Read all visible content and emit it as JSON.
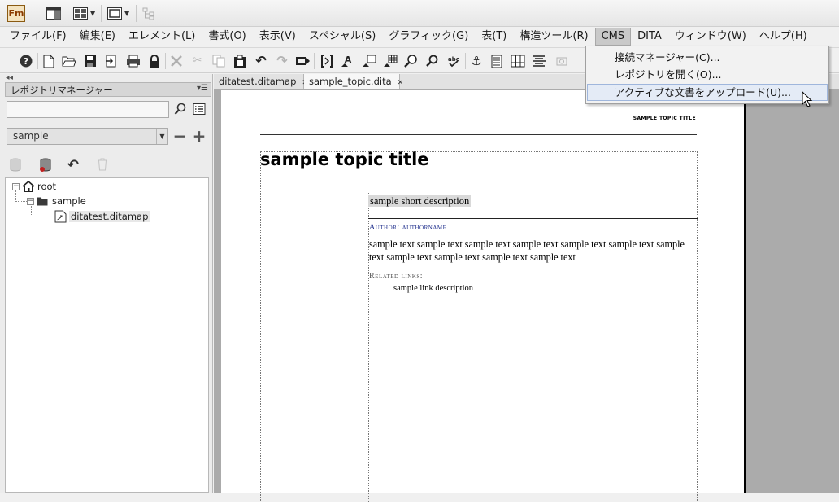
{
  "app": {
    "logo_text": "Fm",
    "titlebar_icons": [
      "workspace-icon",
      "layout-grid-icon",
      "frame-view-icon",
      "tree-disabled-icon"
    ]
  },
  "menubar": {
    "items": [
      {
        "label": "ファイル(F)"
      },
      {
        "label": "編集(E)"
      },
      {
        "label": "エレメント(L)"
      },
      {
        "label": "書式(O)"
      },
      {
        "label": "表示(V)"
      },
      {
        "label": "スペシャル(S)"
      },
      {
        "label": "グラフィック(G)"
      },
      {
        "label": "表(T)"
      },
      {
        "label": "構造ツール(R)"
      },
      {
        "label": "CMS",
        "active": true
      },
      {
        "label": "DITA"
      },
      {
        "label": "ウィンドウ(W)"
      },
      {
        "label": "ヘルプ(H)"
      }
    ]
  },
  "cms_menu": {
    "items": [
      {
        "label": "接続マネージャー(C)..."
      },
      {
        "label": "レポジトリを開く(O)..."
      },
      {
        "label": "アクティブな文書をアップロード(U)...",
        "hover": true
      }
    ]
  },
  "left_panel": {
    "title": "レポジトリマネージャー",
    "search_value": "",
    "repository_selected": "sample",
    "tree": {
      "root_label": "root",
      "folder_label": "sample",
      "file_label": "ditatest.ditamap"
    }
  },
  "doc_tabs": [
    {
      "label": "ditatest.ditamap",
      "active": false
    },
    {
      "label": "sample_topic.dita",
      "active": true
    }
  ],
  "document": {
    "header_title": "SAMPLE TOPIC TITLE",
    "title": "sample topic title",
    "short_description": "sample short description",
    "author": "Author: authorname",
    "body": "sample text sample text sample text sample text sample text sample text sample text sample text sample text sample text sample text",
    "related_links_heading": "Related links:",
    "link_description": "sample link description"
  },
  "colors": {
    "menu_active_bg": "#c9c9c9",
    "dropdown_hover_bg": "#e4ebf6",
    "author_text": "#1a2a8a",
    "doc_background": "#ababab"
  }
}
